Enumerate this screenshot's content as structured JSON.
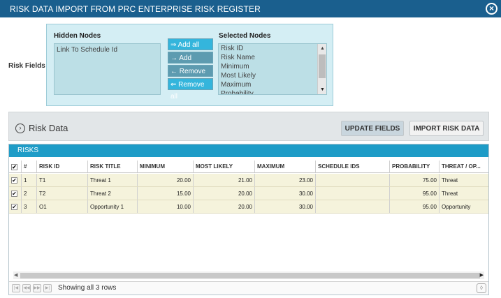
{
  "dialog": {
    "title": "RISK DATA IMPORT FROM PRC ENTERPRISE RISK REGISTER",
    "close_icon": "close-icon"
  },
  "fields": {
    "label": "Risk Fields",
    "hidden_title": "Hidden Nodes",
    "hidden_items": [
      "Link To Schedule Id"
    ],
    "selected_title": "Selected Nodes",
    "selected_items": [
      "Risk ID",
      "Risk Name",
      "Minimum",
      "Most Likely",
      "Maximum",
      "Probability"
    ],
    "buttons": {
      "add_all": "⇒ Add all",
      "add": "→ Add",
      "remove": "← Remove",
      "remove_all": "⇐ Remove all"
    }
  },
  "risk_data": {
    "title": "Risk Data",
    "update_button": "UPDATE FIELDS",
    "import_button": "IMPORT RISK DATA"
  },
  "grid": {
    "caption": "RISKS",
    "columns": [
      "",
      "#",
      "RISK ID",
      "RISK TITLE",
      "MINIMUM",
      "MOST LIKELY",
      "MAXIMUM",
      "SCHEDULE IDS",
      "PROBABILITY",
      "THREAT / OP..."
    ],
    "rows": [
      {
        "checked": "✔",
        "num": "1",
        "id": "T1",
        "title": "Threat 1",
        "min": "20.00",
        "likely": "21.00",
        "max": "23.00",
        "sched": "",
        "prob": "75.00",
        "type": "Threat"
      },
      {
        "checked": "✔",
        "num": "2",
        "id": "T2",
        "title": "Threat 2",
        "min": "15.00",
        "likely": "20.00",
        "max": "30.00",
        "sched": "",
        "prob": "95.00",
        "type": "Threat"
      },
      {
        "checked": "✔",
        "num": "3",
        "id": "O1",
        "title": "Opportunity 1",
        "min": "10.00",
        "likely": "20.00",
        "max": "30.00",
        "sched": "",
        "prob": "95.00",
        "type": "Opportunity"
      }
    ],
    "footer": "Showing all 3 rows"
  }
}
